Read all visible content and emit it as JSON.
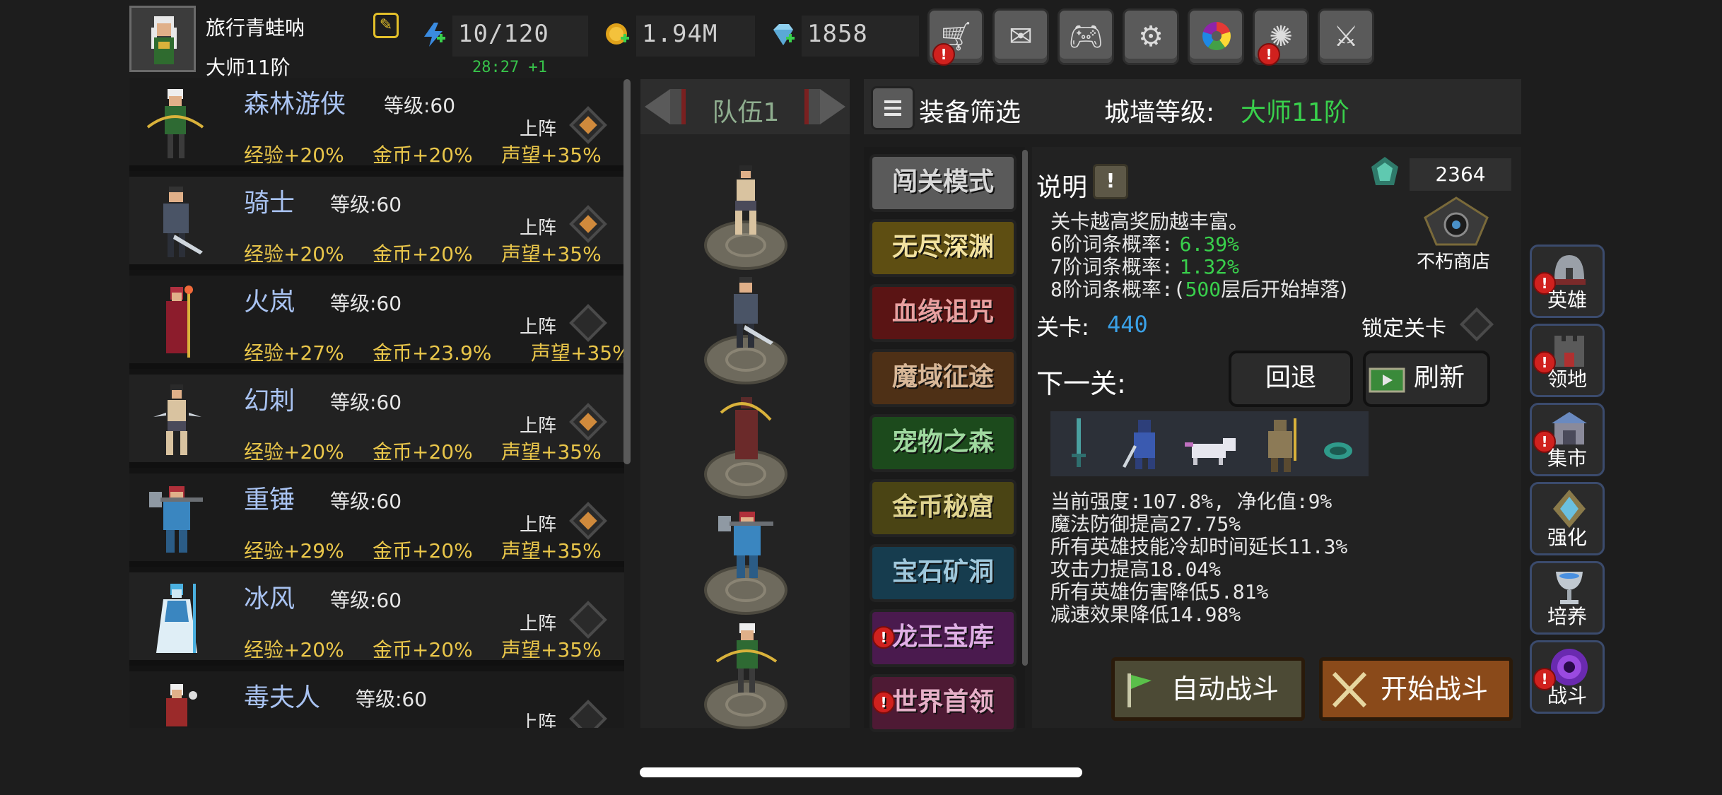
{
  "player": {
    "name": "旅行青蛙呐",
    "rank": "大师11阶",
    "edit_icon": "edit-icon"
  },
  "resources": {
    "energy": "10/120",
    "energy_timer": "28:27 +1",
    "gold": "1.94M",
    "gems": "1858"
  },
  "top_buttons": [
    {
      "icon": "cart-icon",
      "alert": true
    },
    {
      "icon": "mail-icon",
      "alert": false
    },
    {
      "icon": "gamepad-icon",
      "alert": false
    },
    {
      "icon": "gear-icon",
      "alert": false
    },
    {
      "icon": "color-wheel-icon",
      "alert": false
    },
    {
      "icon": "fireworks-icon",
      "alert": true
    },
    {
      "icon": "crossed-swords-icon",
      "alert": false
    }
  ],
  "heroes": [
    {
      "name": "森林游侠",
      "level": "等级:60",
      "deploy": "上阵",
      "deployed": true,
      "exp": "经验+20%",
      "gold": "金币+20%",
      "fame": "声望+35%"
    },
    {
      "name": "骑士",
      "level": "等级:60",
      "deploy": "上阵",
      "deployed": true,
      "exp": "经验+20%",
      "gold": "金币+20%",
      "fame": "声望+35%"
    },
    {
      "name": "火岚",
      "level": "等级:60",
      "deploy": "上阵",
      "deployed": false,
      "exp": "经验+27%",
      "gold": "金币+23.9%",
      "fame": "声望+35%"
    },
    {
      "name": "幻刺",
      "level": "等级:60",
      "deploy": "上阵",
      "deployed": true,
      "exp": "经验+20%",
      "gold": "金币+20%",
      "fame": "声望+35%"
    },
    {
      "name": "重锤",
      "level": "等级:60",
      "deploy": "上阵",
      "deployed": true,
      "exp": "经验+29%",
      "gold": "金币+20%",
      "fame": "声望+35%"
    },
    {
      "name": "冰风",
      "level": "等级:60",
      "deploy": "上阵",
      "deployed": false,
      "exp": "经验+20%",
      "gold": "金币+20%",
      "fame": "声望+35%"
    },
    {
      "name": "毒夫人",
      "level": "等级:60",
      "deploy": "上阵",
      "deployed": false,
      "exp": "",
      "gold": "",
      "fame": ""
    }
  ],
  "team": {
    "label": "队伍1"
  },
  "filter": {
    "label": "装备筛选",
    "wall_label": "城墙等级:",
    "wall_value": "大师11阶"
  },
  "modes": [
    {
      "label": "闯关模式",
      "alert": false
    },
    {
      "label": "无尽深渊",
      "alert": false
    },
    {
      "label": "血缘诅咒",
      "alert": false
    },
    {
      "label": "魔域征途",
      "alert": false
    },
    {
      "label": "宠物之森",
      "alert": false
    },
    {
      "label": "金币秘窟",
      "alert": false
    },
    {
      "label": "宝石矿洞",
      "alert": false
    },
    {
      "label": "龙王宝库",
      "alert": true
    },
    {
      "label": "世界首领",
      "alert": true
    }
  ],
  "info": {
    "desc_label": "说明",
    "desc_btn": "!",
    "gem_count": "2364",
    "shop_label": "不朽商店",
    "line1": "关卡越高奖励越丰富。",
    "p6_label": "6阶词条概率:",
    "p6_value": "6.39%",
    "p7_label": "7阶词条概率:",
    "p7_value": "1.32%",
    "p8_label": "8阶词条概率:(",
    "p8_value": "500",
    "p8_suffix": "层后开始掉落)",
    "stage_label": "关卡:",
    "stage_value": "440",
    "lock_label": "锁定关卡",
    "next_label": "下一关:",
    "back_btn": "回退",
    "refresh_btn": "刷新",
    "effects": [
      "当前强度:107.8%, 净化值:9%",
      "魔法防御提高27.75%",
      "所有英雄技能冷却时间延长11.3%",
      "攻击力提高18.04%",
      "所有英雄伤害降低5.81%",
      "减速效果降低14.98%"
    ],
    "auto_btn": "自动战斗",
    "start_btn": "开始战斗"
  },
  "side_menu": [
    {
      "label": "英雄",
      "icon": "helmet-icon",
      "alert": true
    },
    {
      "label": "领地",
      "icon": "castle-icon",
      "alert": true
    },
    {
      "label": "集市",
      "icon": "market-icon",
      "alert": true
    },
    {
      "label": "强化",
      "icon": "crystal-icon",
      "alert": false
    },
    {
      "label": "培养",
      "icon": "chalice-icon",
      "alert": false
    },
    {
      "label": "战斗",
      "icon": "portal-icon",
      "alert": true
    }
  ],
  "colors": {
    "accent_green": "#39d04c",
    "hero_name_blue": "#a9c3f2",
    "bonus_gold": "#e9c64a",
    "stage_blue": "#3aa0e6"
  }
}
